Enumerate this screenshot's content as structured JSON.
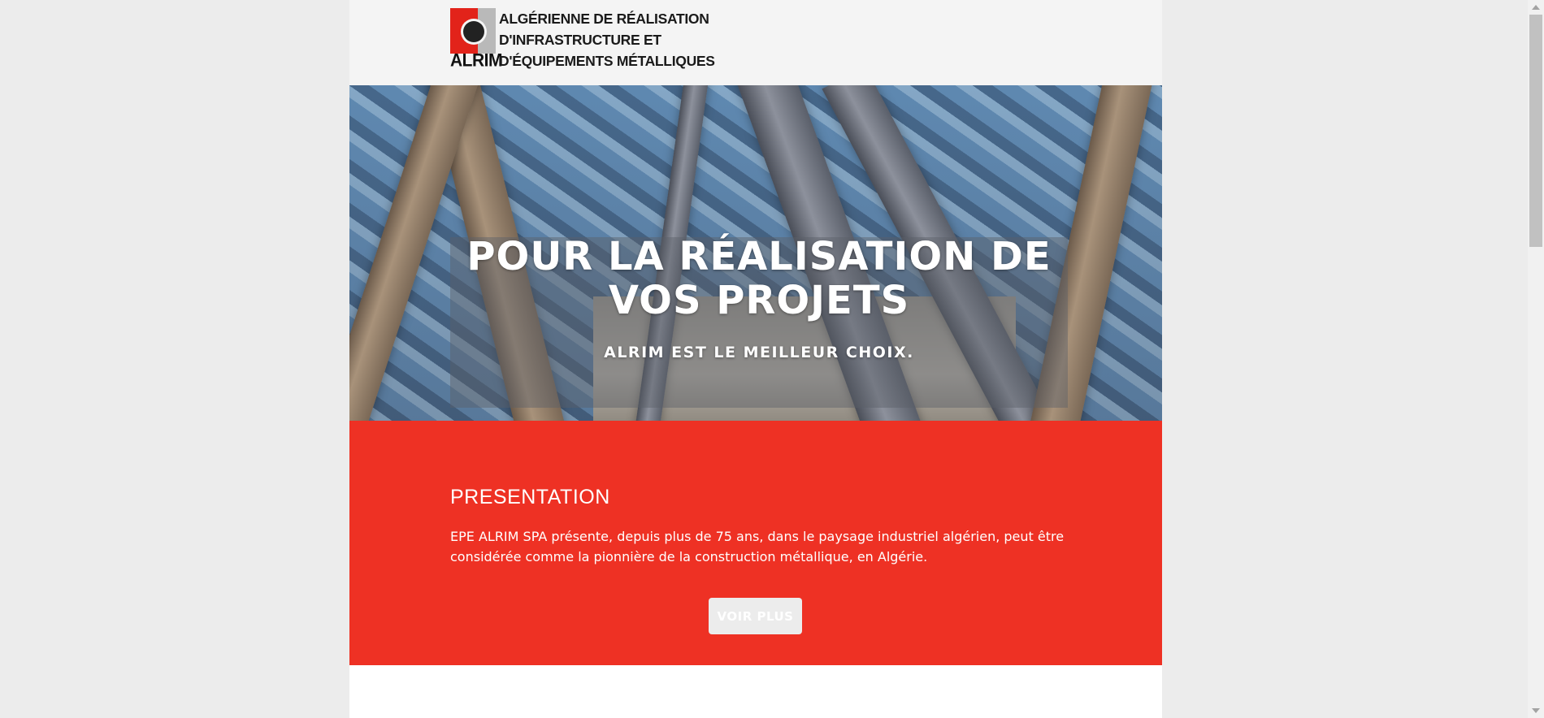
{
  "header": {
    "logo_abbr": "ALRIM",
    "company_name_lines": [
      "ALGÉRIENNE DE RÉALISATION",
      "D'INFRASTRUCTURE ET",
      "D'ÉQUIPEMENTS MÉTALLIQUES"
    ]
  },
  "hero": {
    "title": "POUR LA RÉALISATION DE VOS PROJETS",
    "subtitle": "ALRIM EST LE MEILLEUR CHOIX."
  },
  "presentation": {
    "title": "PRESENTATION",
    "text": "EPE ALRIM SPA présente, depuis plus de 75 ans, dans le paysage industriel algérien, peut être considérée comme la pionnière de la construction métallique, en Algérie.",
    "button_label": "VOIR PLUS"
  },
  "colors": {
    "brand_red": "#ee3124",
    "header_bg": "#f4f4f4",
    "page_bg": "#ececec"
  }
}
